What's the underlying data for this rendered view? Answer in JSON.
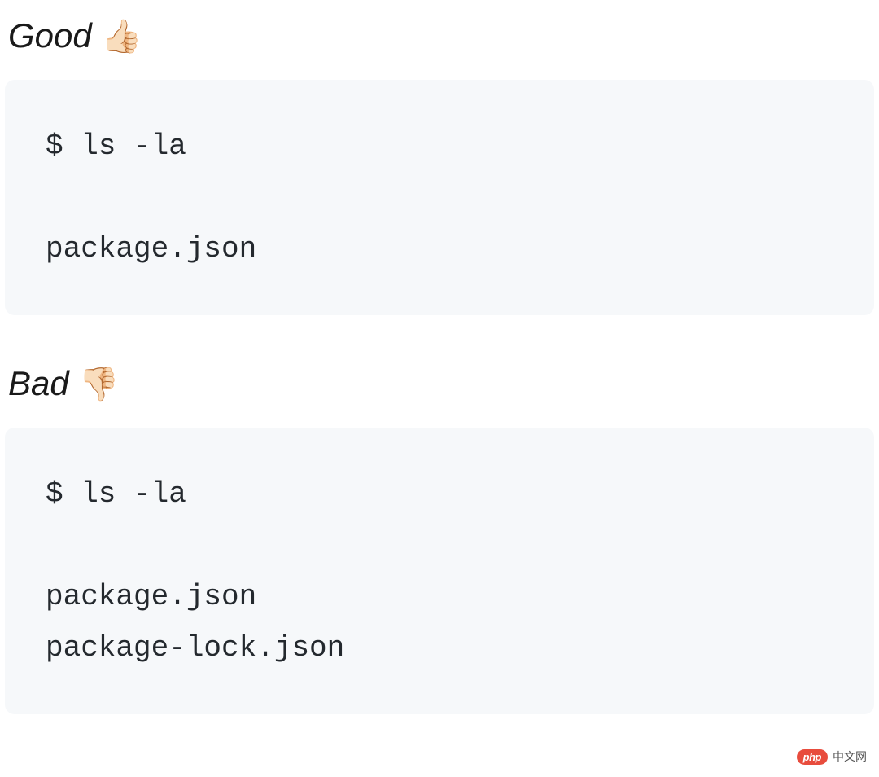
{
  "good": {
    "label": "Good",
    "emoji": "👍🏻",
    "code": "$ ls -la\n\npackage.json"
  },
  "bad": {
    "label": "Bad",
    "emoji": "👎🏻",
    "code": "$ ls -la\n\npackage.json\npackage-lock.json"
  },
  "watermark": {
    "badge": "php",
    "text": "中文网"
  }
}
